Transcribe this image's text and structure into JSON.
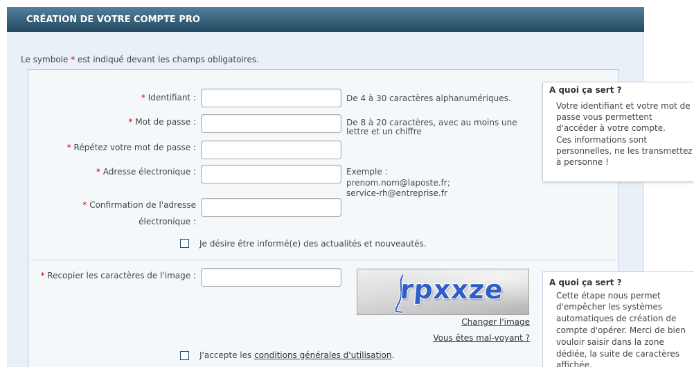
{
  "header": {
    "title": "CRÉATION DE VOTRE COMPTE PRO"
  },
  "intro": {
    "before": "Le symbole ",
    "mark": "*",
    "after": " est indiqué devant les champs obligatoires."
  },
  "form": {
    "required_mark": "*",
    "identifiant": {
      "label": "Identifiant :",
      "value": "",
      "hint": "De 4 à 30 caractères alphanumériques."
    },
    "password": {
      "label": "Mot de passe :",
      "value": "",
      "hint_lines": [
        "De 8 à 20 caractères, avec au moins une",
        "lettre et un chiffre"
      ]
    },
    "password_confirm": {
      "label": "Répétez votre mot de passe :",
      "value": ""
    },
    "email": {
      "label": "Adresse électronique :",
      "value": "",
      "hint_lines": [
        "Exemple :",
        "prenom.nom@laposte.fr;",
        "service-rh@entreprise.fr"
      ]
    },
    "email_confirm": {
      "label_lines": [
        "Confirmation de l'adresse",
        "électronique :"
      ],
      "value": ""
    },
    "newsletter": {
      "label": "Je désire être informé(e) des actualités et nouveautés.",
      "checked": false
    },
    "captcha": {
      "label": "Recopier les caractères de l'image :",
      "value": "",
      "image_text": "rpxxze",
      "change_image_link": "Changer l'image",
      "visually_impaired_link": "Vous êtes mal-voyant ?"
    },
    "terms": {
      "before": "J'accepte les ",
      "link": "conditions générales d'utilisation",
      "after": ".",
      "checked": false
    }
  },
  "info_boxes": [
    {
      "title": "A quoi ça sert ?",
      "lines": [
        "Votre identifiant et votre mot de",
        "passe vous permettent",
        "d'accéder à votre compte.",
        "Ces informations sont",
        "personnelles, ne les transmettez",
        "à personne !"
      ]
    },
    {
      "title": "A quoi ça sert ?",
      "lines": [
        "Cette étape nous permet",
        "d'empêcher les systèmes",
        "automatiques de création de",
        "compte d'opérer. Merci de bien",
        "vouloir saisir dans la zone",
        "dédiée, la suite de caractères",
        "affichée."
      ]
    }
  ],
  "colors": {
    "header_top": "#527f9b",
    "header_bottom": "#23495f",
    "panel_bg": "#e9f0f7",
    "form_bg": "#f4f8fb",
    "required_mark": "#d40000",
    "link": "#333333",
    "captcha_text": "#2f5ec6"
  }
}
